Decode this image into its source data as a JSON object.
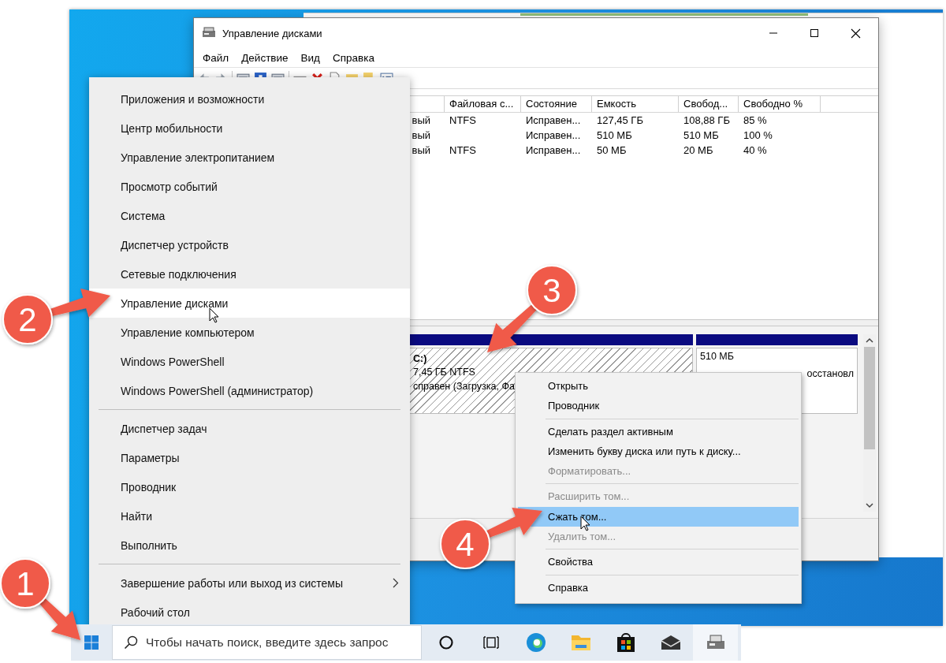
{
  "disk_window": {
    "title": "Управление дисками",
    "menu": [
      "Файл",
      "Действие",
      "Вид",
      "Справка"
    ],
    "table": {
      "columns": [
        "Файловая с...",
        "Состояние",
        "Емкость",
        "Свобод...",
        "Свободно %"
      ],
      "rows": [
        {
          "column_1": "вый",
          "file_system": "NTFS",
          "status": "Исправен...",
          "capacity": "127,45 ГБ",
          "free": "108,88 ГБ",
          "free_percent": "85 %"
        },
        {
          "column_1": "вый",
          "status": "Исправен...",
          "capacity": "510 МБ",
          "free": "510 МБ",
          "free_percent": "100 %"
        },
        {
          "column_1": "вый",
          "file_system": "NTFS",
          "status": "Исправен...",
          "capacity": "50 МБ",
          "free": "20 МБ",
          "free_percent": "40 %"
        }
      ]
    },
    "partitions": [
      {
        "name": "C:)",
        "size": "7,45 ГБ NTFS",
        "status": "справен (Загрузка, Фа",
        "selected": true
      },
      {
        "size": "510 МБ",
        "status": "осстановл",
        "selected": false
      }
    ]
  },
  "start_menu": {
    "groups": [
      [
        {
          "label": "Приложения и возможности",
          "selected": false,
          "submenu": false
        },
        {
          "label": "Центр мобильности",
          "selected": false,
          "submenu": false
        },
        {
          "label": "Управление электропитанием",
          "selected": false,
          "submenu": false
        },
        {
          "label": "Просмотр событий",
          "selected": false,
          "submenu": false
        },
        {
          "label": "Система",
          "selected": false,
          "submenu": false
        },
        {
          "label": "Диспетчер устройств",
          "selected": false,
          "submenu": false
        },
        {
          "label": "Сетевые подключения",
          "selected": false,
          "submenu": false
        },
        {
          "label": "Управление дисками",
          "selected": true,
          "submenu": false
        },
        {
          "label": "Управление компьютером",
          "selected": false,
          "submenu": false
        },
        {
          "label": "Windows PowerShell",
          "selected": false,
          "submenu": false
        },
        {
          "label": "Windows PowerShell (администратор)",
          "selected": false,
          "submenu": false
        }
      ],
      [
        {
          "label": "Диспетчер задач",
          "selected": false,
          "submenu": false
        },
        {
          "label": "Параметры",
          "selected": false,
          "submenu": false
        },
        {
          "label": "Проводник",
          "selected": false,
          "submenu": false
        },
        {
          "label": "Найти",
          "selected": false,
          "submenu": false
        },
        {
          "label": "Выполнить",
          "selected": false,
          "submenu": false
        }
      ],
      [
        {
          "label": "Завершение работы или выход из системы",
          "selected": false,
          "submenu": true
        },
        {
          "label": "Рабочий стол",
          "selected": false,
          "submenu": false
        }
      ]
    ]
  },
  "context_menu": {
    "groups": [
      [
        {
          "label": "Открыть",
          "disabled": false,
          "selected": false
        },
        {
          "label": "Проводник",
          "disabled": false,
          "selected": false
        }
      ],
      [
        {
          "label": "Сделать раздел активным",
          "disabled": false,
          "selected": false
        },
        {
          "label": "Изменить букву диска или путь к диску...",
          "disabled": false,
          "selected": false
        },
        {
          "label": "Форматировать...",
          "disabled": true,
          "selected": false
        }
      ],
      [
        {
          "label": "Расширить том...",
          "disabled": true,
          "selected": false
        },
        {
          "label": "Сжать том...",
          "disabled": false,
          "selected": true
        },
        {
          "label": "Удалить том...",
          "disabled": true,
          "selected": false
        }
      ],
      [
        {
          "label": "Свойства",
          "disabled": false,
          "selected": false
        }
      ],
      [
        {
          "label": "Справка",
          "disabled": false,
          "selected": false
        }
      ]
    ]
  },
  "taskbar": {
    "search": {
      "placeholder": "Чтобы начать поиск, введите здесь запрос"
    },
    "apps": [
      {
        "kind": "cortana",
        "selected": false
      },
      {
        "kind": "task-view",
        "selected": false
      },
      {
        "kind": "browser",
        "selected": false
      },
      {
        "kind": "folder",
        "selected": false
      },
      {
        "kind": "store",
        "selected": false
      },
      {
        "kind": "mail",
        "selected": false
      },
      {
        "kind": "disk-manager",
        "selected": true
      }
    ]
  },
  "callouts": [
    "1",
    "2",
    "3",
    "4"
  ]
}
